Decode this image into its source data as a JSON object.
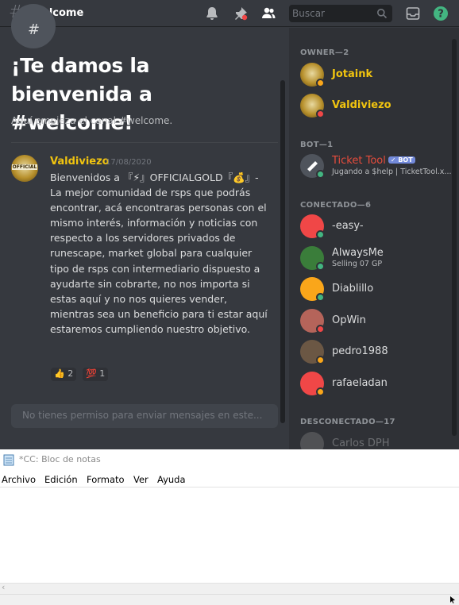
{
  "discord": {
    "channel": "welcome",
    "search_placeholder": "Buscar",
    "welcome_title": "¡Te damos la bienvenida a #welcome!",
    "welcome_subtitle": "Aquí empieza el canal #welcome.",
    "message": {
      "author": "Valdiviezo",
      "date": "17/08/2020",
      "avatar_text": "OFFICIAL",
      "text": "Bienvenidos a 『⚡』OFFICIALGOLD『💰』- La mejor comunidad de rsps que podrás encontrar, acá encontraras personas con el mismo interés, información y noticias con respecto a los servidores privados de runescape, market global para cualquier tipo de rsps con intermediario dispuesto a ayudarte sin cobrarte, no nos importa si estas aquí y no nos quieres vender, mientras sea un beneficio para ti estar aquí estaremos cumpliendo nuestro objetivo.",
      "reactions": [
        {
          "emoji": "👍",
          "count": "2"
        },
        {
          "emoji": "💯",
          "count": "1"
        }
      ]
    },
    "input_placeholder": "No tienes permiso para enviar mensajes en este...",
    "members": {
      "owner_header": "OWNER—2",
      "owners": [
        {
          "name": "Jotaink",
          "color": "#f1c40f",
          "status_color": "#faa61a"
        },
        {
          "name": "Valdiviezo",
          "color": "#f1c40f",
          "status_color": "#f04747"
        }
      ],
      "bot_header": "BOT—1",
      "bots": [
        {
          "name": "Ticket Tool",
          "badge": "✓ BOT",
          "activity": "Jugando a $help | TicketTool.x...",
          "color": "#e74c3c",
          "status_color": "#43b581"
        }
      ],
      "online_header": "CONECTADO—6",
      "online": [
        {
          "name": "-easy-",
          "activity": "",
          "status_color": "#43b581",
          "avatar_bg": "#f04747"
        },
        {
          "name": "AlwaysMe",
          "activity": "Selling 07 GP",
          "status_color": "#43b581",
          "avatar_bg": "#3a7d3a"
        },
        {
          "name": "Diablillo",
          "activity": "",
          "status_color": "#43b581",
          "avatar_bg": "#faa61a"
        },
        {
          "name": "OpWin",
          "activity": "",
          "status_color": "#f04747",
          "avatar_bg": "#b5645a"
        },
        {
          "name": "pedro1988",
          "activity": "",
          "status_color": "#faa61a",
          "avatar_bg": "#6b5744"
        },
        {
          "name": "rafaeladan",
          "activity": "",
          "status_color": "#faa61a",
          "avatar_bg": "#f04747"
        }
      ],
      "offline_header": "DESCONECTADO—17",
      "offline": [
        {
          "name": "Carlos DPH"
        }
      ]
    }
  },
  "notepad": {
    "title": "*CC: Bloc de notas",
    "menu": [
      "Archivo",
      "Edición",
      "Formato",
      "Ver",
      "Ayuda"
    ]
  }
}
